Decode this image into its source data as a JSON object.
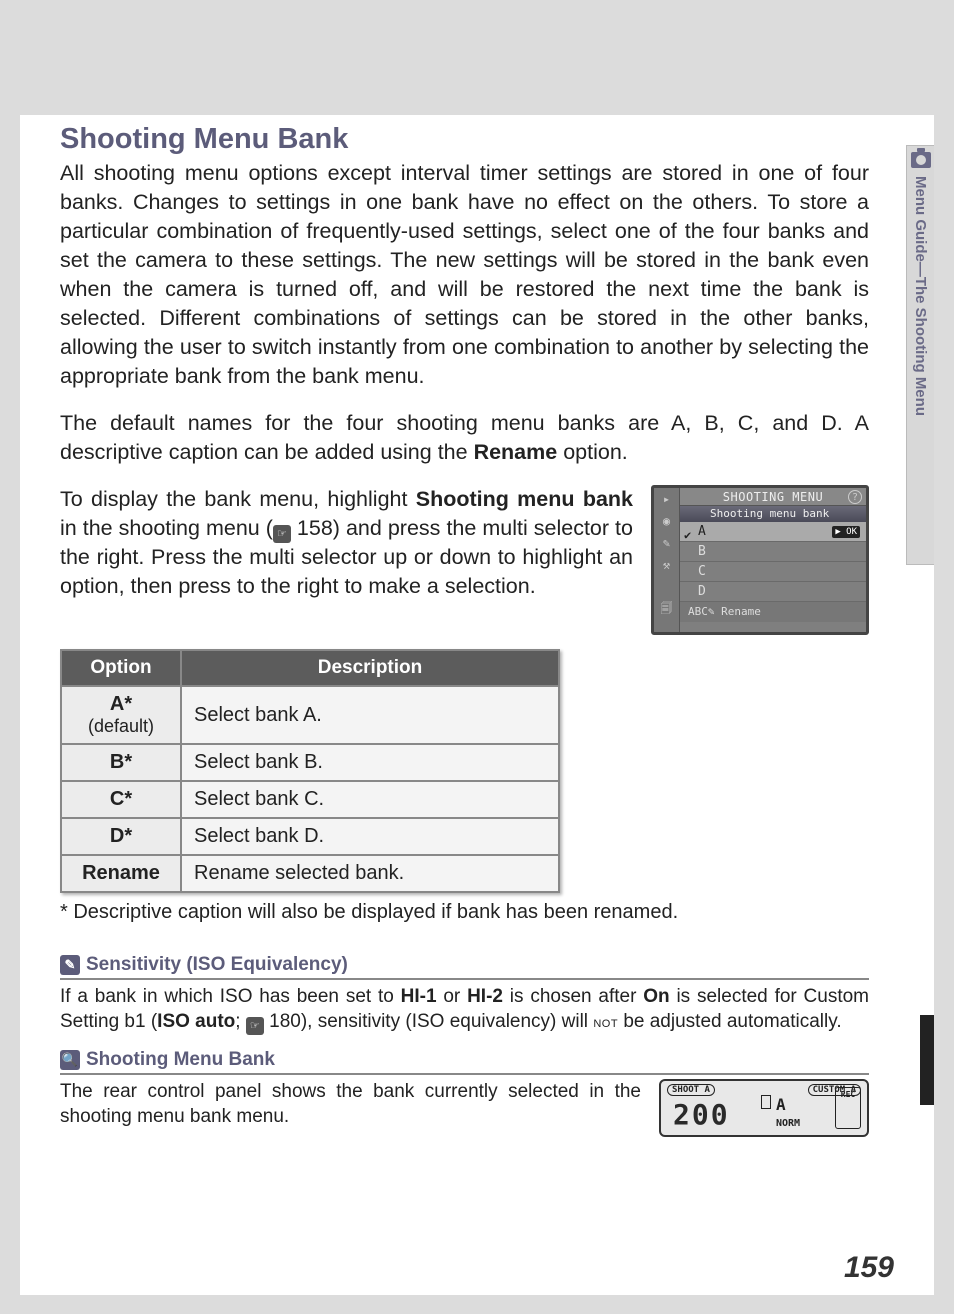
{
  "sideTab": "Menu Guide—The Shooting Menu",
  "title": "Shooting Menu Bank",
  "para1_a": "All shooting menu options except interval timer settings are stored in one of four banks.  Changes to settings in one bank have no effect on the others.  To store a particular combination of frequently-used settings, select one of the four banks and set the camera to these settings.  The new settings will be stored in the bank even when the camera is turned off, and will be restored the next time the bank is selected.  Different combinations of settings can be stored in the other banks, allowing the user to switch instantly from one combination to another by selecting the appropriate bank from the bank menu.",
  "para2_a": "The default names for the four shooting menu banks are A, B, C, and D.  A descriptive caption can be added using the ",
  "para2_b": "Rename",
  "para2_c": " option.",
  "para3_a": "To display the bank menu, highlight ",
  "para3_b": "Shooting menu bank",
  "para3_c": " in the shooting menu (",
  "para3_ref": "158",
  "para3_d": ") and press the multi selector to the right.  Press the multi selector up or down to highlight an option, then press to the right to make a selection.",
  "menuShot": {
    "title": "SHOOTING MENU",
    "subtitle": "Shooting menu bank",
    "rows": [
      "A",
      "B",
      "C",
      "D"
    ],
    "rename": "ABC✎ Rename",
    "ok": "▶ OK"
  },
  "table": {
    "h1": "Option",
    "h2": "Description",
    "rows": [
      {
        "opt": "A*",
        "sub": "(default)",
        "desc": "Select bank A."
      },
      {
        "opt": "B*",
        "sub": "",
        "desc": "Select bank B."
      },
      {
        "opt": "C*",
        "sub": "",
        "desc": "Select bank C."
      },
      {
        "opt": "D*",
        "sub": "",
        "desc": "Select bank D."
      },
      {
        "opt": "Rename",
        "sub": "",
        "desc": "Rename selected bank."
      }
    ]
  },
  "footnote": "* Descriptive caption will also be displayed if bank has been renamed.",
  "note1": {
    "title": "Sensitivity (ISO Equivalency)",
    "a": "If a bank in which ISO has been set to ",
    "b": "HI-1",
    "c": " or ",
    "d": "HI-2",
    "e": " is chosen after ",
    "f": "On",
    "g": " is selected for Custom Setting b1 (",
    "h": "ISO auto",
    "i": "; ",
    "ref": "180",
    "j": "), sensitivity (ISO equivalency) will ",
    "not": "not",
    "k": " be adjusted automatically."
  },
  "note2": {
    "title": "Shooting Menu Bank",
    "body": "The rear control panel shows the bank currently selected in the shooting menu bank menu."
  },
  "lcd": {
    "shoot": "SHOOT A",
    "custom": "CUSTOM A",
    "rec": "REC",
    "big": "200",
    "a": "A",
    "norm": "NORM"
  },
  "pageNum": "159"
}
